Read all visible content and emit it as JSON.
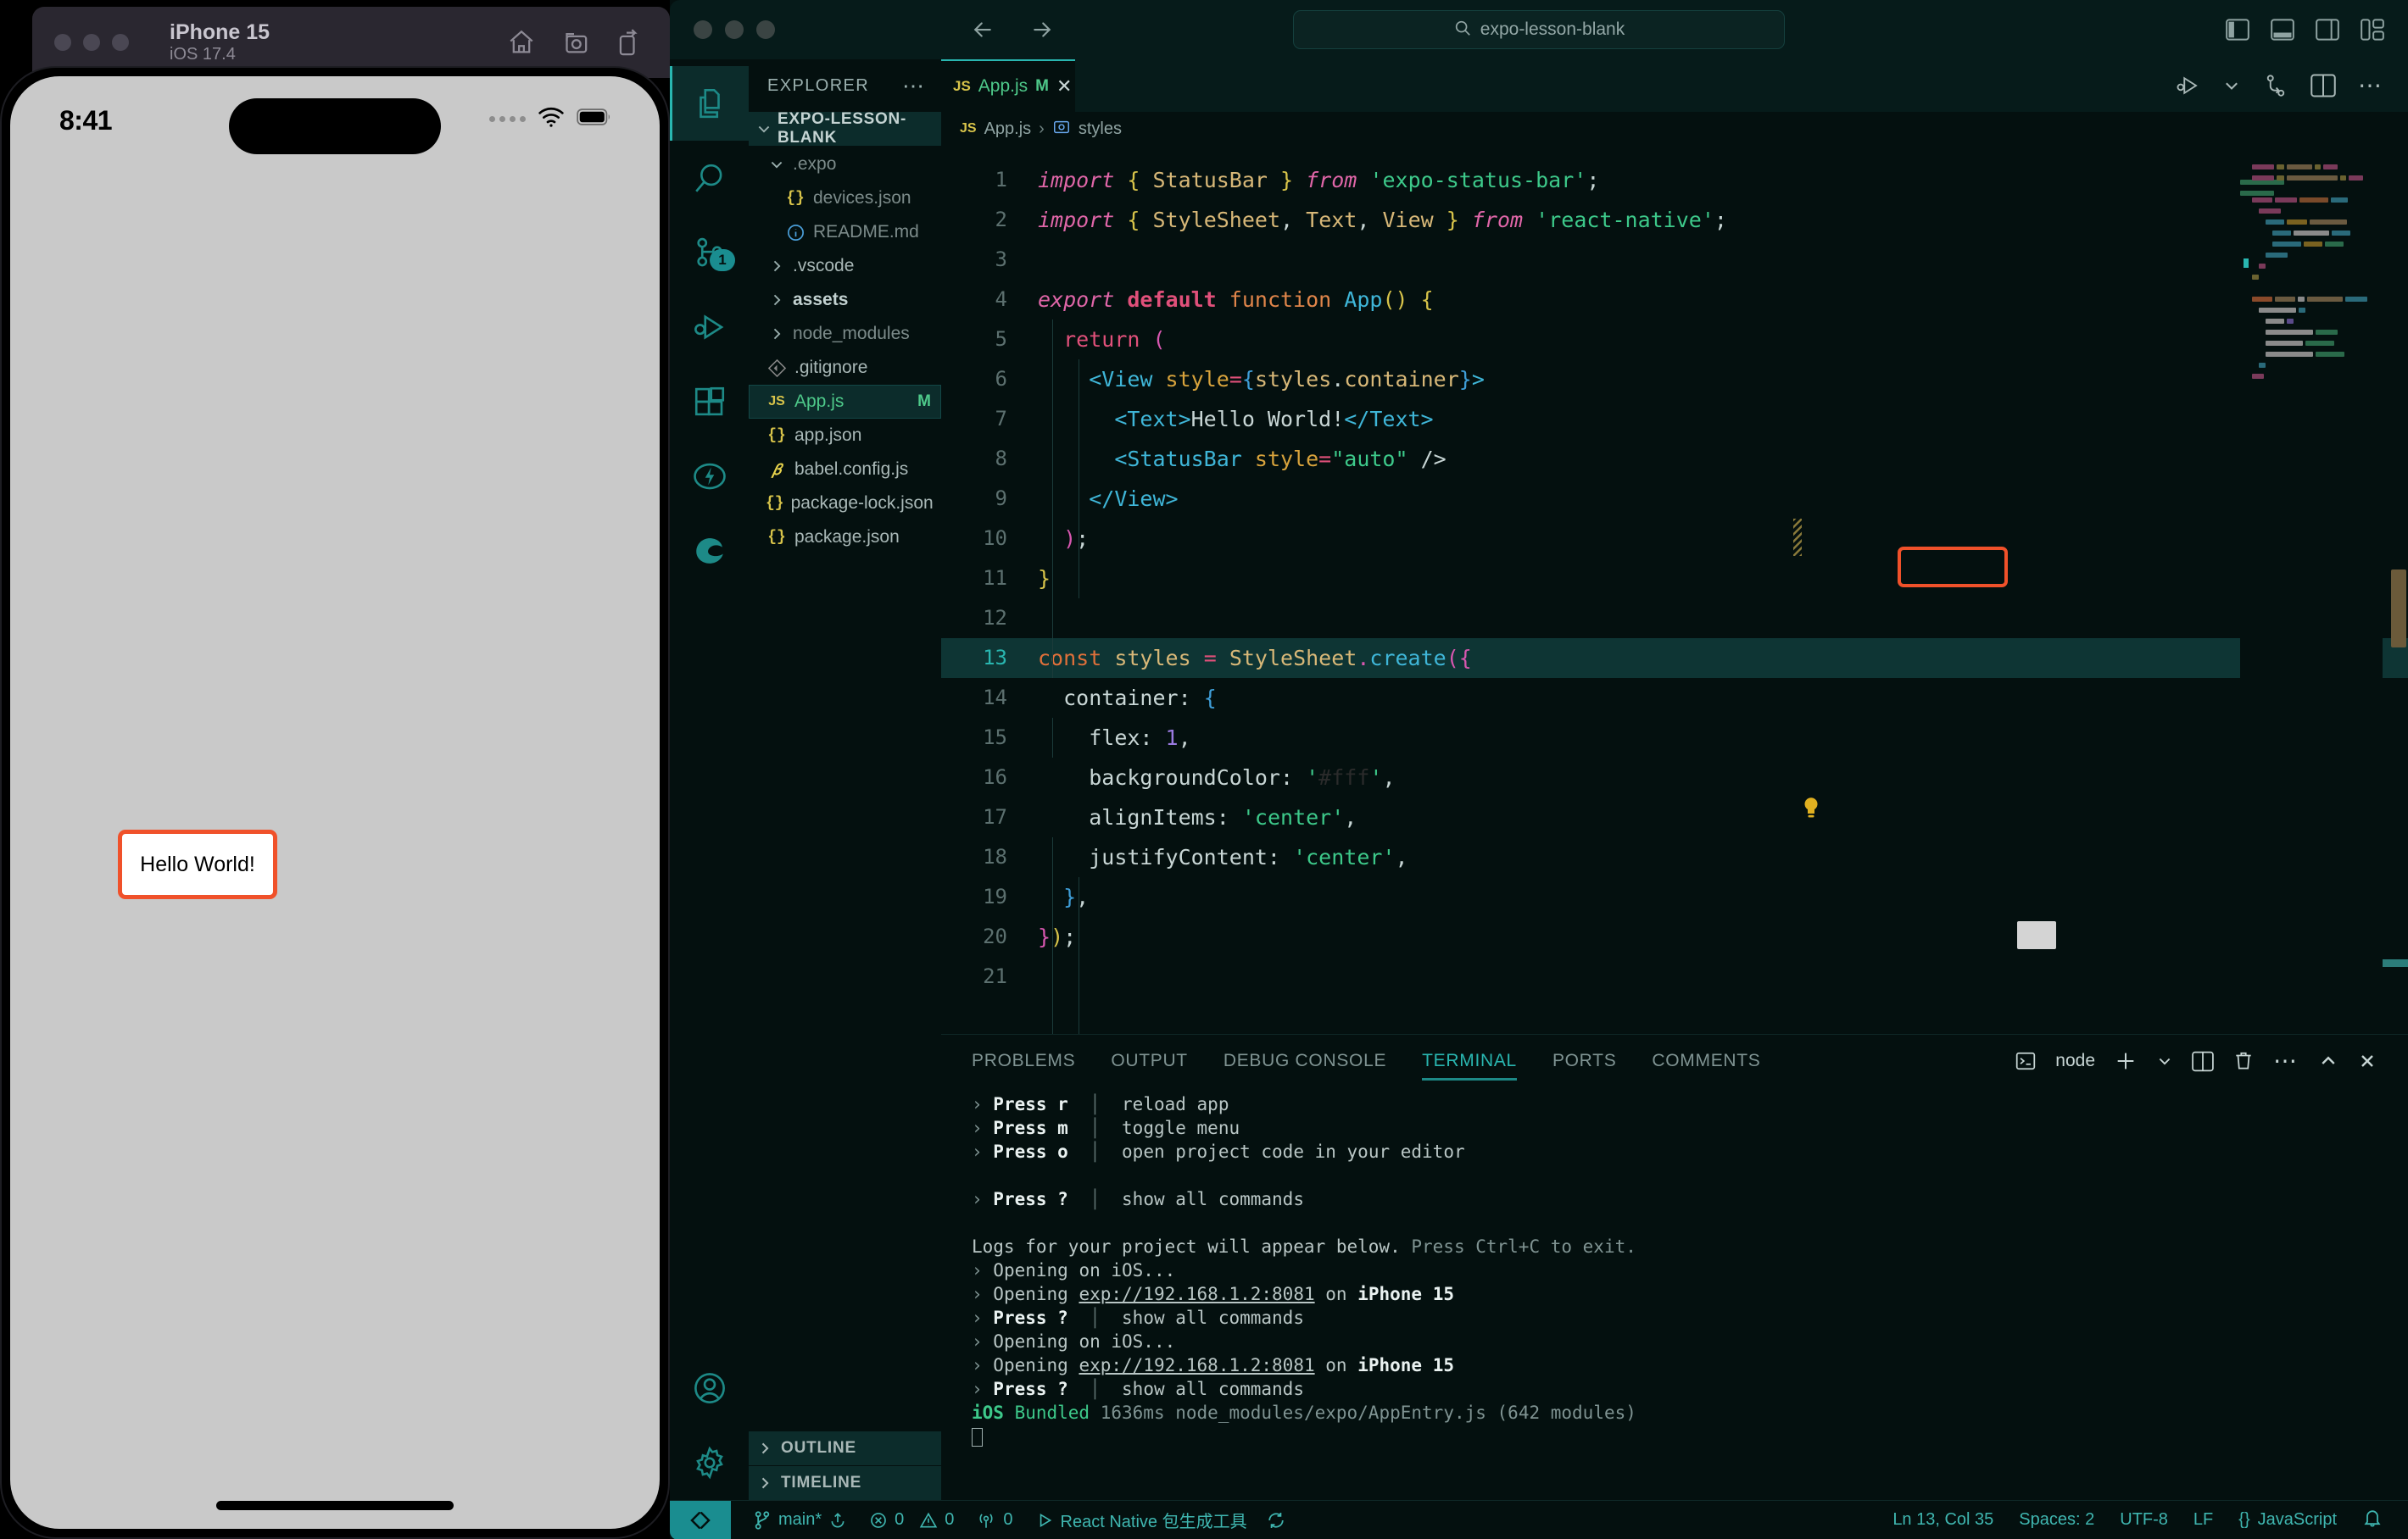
{
  "simulator": {
    "window_lights": [
      "close",
      "minimize",
      "maximize"
    ],
    "device_name": "iPhone 15",
    "os_version": "iOS 17.4",
    "toolbar_icons": [
      "home-icon",
      "screenshot-icon",
      "rotate-icon"
    ],
    "status_time": "8:41",
    "status_icons": [
      "cellular-dots-icon",
      "wifi-icon",
      "battery-icon"
    ],
    "app": {
      "text": "Hello World!",
      "highlight_color": "#f0512a",
      "background": "#ffffff"
    }
  },
  "titlebar": {
    "lights": [
      "close",
      "minimize",
      "maximize"
    ],
    "back_label": "back-arrow",
    "forward_label": "forward-arrow",
    "search_text": "expo-lesson-blank",
    "layout_icons": [
      "toggle-primary-sidebar",
      "toggle-panel",
      "toggle-secondary-sidebar",
      "customize-layout"
    ]
  },
  "activitybar": {
    "items": [
      {
        "name": "explorer",
        "icon": "files-icon",
        "active": true,
        "badge": null
      },
      {
        "name": "search",
        "icon": "search-icon",
        "active": false,
        "badge": null
      },
      {
        "name": "source-control",
        "icon": "source-control-icon",
        "active": false,
        "badge": "1"
      },
      {
        "name": "run-debug",
        "icon": "run-debug-icon",
        "active": false,
        "badge": null
      },
      {
        "name": "extensions",
        "icon": "extensions-icon",
        "active": false,
        "badge": null
      },
      {
        "name": "expo-tools",
        "icon": "lightning-icon",
        "active": false,
        "badge": null
      },
      {
        "name": "edge-tools",
        "icon": "edge-icon",
        "active": false,
        "badge": null
      }
    ],
    "bottom": [
      {
        "name": "accounts",
        "icon": "account-icon"
      },
      {
        "name": "manage",
        "icon": "gear-icon"
      }
    ]
  },
  "sidebar": {
    "header": "EXPLORER",
    "more_icon": "ellipsis-icon",
    "root": "EXPO-LESSON-BLANK",
    "files": [
      {
        "label": ".expo",
        "icon": "folder",
        "indent": 1,
        "chevron": "down",
        "style": "dim",
        "mark": ""
      },
      {
        "label": "devices.json",
        "icon": "json",
        "indent": 2,
        "chevron": "",
        "style": "dim",
        "mark": ""
      },
      {
        "label": "README.md",
        "icon": "md",
        "indent": 2,
        "chevron": "",
        "style": "dim",
        "mark": ""
      },
      {
        "label": ".vscode",
        "icon": "folder",
        "indent": 1,
        "chevron": "right",
        "style": "",
        "mark": ""
      },
      {
        "label": "assets",
        "icon": "folder",
        "indent": 1,
        "chevron": "right",
        "style": "bold",
        "mark": ""
      },
      {
        "label": "node_modules",
        "icon": "folder",
        "indent": 1,
        "chevron": "right",
        "style": "dim",
        "mark": ""
      },
      {
        "label": ".gitignore",
        "icon": "git",
        "indent": 1,
        "chevron": "",
        "style": "",
        "mark": ""
      },
      {
        "label": "App.js",
        "icon": "js",
        "indent": 1,
        "chevron": "",
        "style": "green",
        "mark": "M",
        "selected": true
      },
      {
        "label": "app.json",
        "icon": "json",
        "indent": 1,
        "chevron": "",
        "style": "",
        "mark": ""
      },
      {
        "label": "babel.config.js",
        "icon": "babel",
        "indent": 1,
        "chevron": "",
        "style": "",
        "mark": ""
      },
      {
        "label": "package-lock.json",
        "icon": "json",
        "indent": 1,
        "chevron": "",
        "style": "",
        "mark": ""
      },
      {
        "label": "package.json",
        "icon": "json",
        "indent": 1,
        "chevron": "",
        "style": "",
        "mark": ""
      }
    ],
    "sections": [
      "OUTLINE",
      "TIMELINE"
    ]
  },
  "editor": {
    "tab": {
      "icon": "JS",
      "name": "App.js",
      "modified": "M",
      "close": "✕"
    },
    "toolbar_icons": [
      "run-debug-icon",
      "chevron-down-icon",
      "source-control-icon",
      "split-editor-icon",
      "more-actions-icon"
    ],
    "breadcrumb": {
      "file_icon": "JS",
      "file": "App.js",
      "separator": "›",
      "symbol_icon": "variable-icon",
      "symbol": "styles"
    },
    "cursor_line": 13,
    "highlight_box_color": "#f0512a",
    "color_swatch": "#ffffff",
    "lines": [
      {
        "n": 1,
        "text": "import { StatusBar } from 'expo-status-bar';"
      },
      {
        "n": 2,
        "text": "import { StyleSheet, Text, View } from 'react-native';"
      },
      {
        "n": 3,
        "text": ""
      },
      {
        "n": 4,
        "text": "export default function App() {"
      },
      {
        "n": 5,
        "text": "  return ("
      },
      {
        "n": 6,
        "text": "    <View style={styles.container}>"
      },
      {
        "n": 7,
        "text": "      <Text>Hello World!</Text>"
      },
      {
        "n": 8,
        "text": "      <StatusBar style=\"auto\" />"
      },
      {
        "n": 9,
        "text": "    </View>"
      },
      {
        "n": 10,
        "text": "  );"
      },
      {
        "n": 11,
        "text": "}"
      },
      {
        "n": 12,
        "text": ""
      },
      {
        "n": 13,
        "text": "const styles = StyleSheet.create({"
      },
      {
        "n": 14,
        "text": "  container: {"
      },
      {
        "n": 15,
        "text": "    flex: 1,"
      },
      {
        "n": 16,
        "text": "    backgroundColor: '#fff',"
      },
      {
        "n": 17,
        "text": "    alignItems: 'center',"
      },
      {
        "n": 18,
        "text": "    justifyContent: 'center',"
      },
      {
        "n": 19,
        "text": "  },"
      },
      {
        "n": 20,
        "text": "});"
      },
      {
        "n": 21,
        "text": ""
      }
    ]
  },
  "panel": {
    "tabs": [
      "PROBLEMS",
      "OUTPUT",
      "DEBUG CONSOLE",
      "TERMINAL",
      "PORTS",
      "COMMENTS"
    ],
    "active_tab": "TERMINAL",
    "shell_label": "node",
    "actions": [
      "terminal-icon",
      "new-terminal-icon",
      "chevron-down-icon",
      "split-terminal-icon",
      "kill-terminal-icon",
      "more-actions-icon",
      "maximize-panel-icon",
      "close-panel-icon"
    ],
    "terminal_lines": [
      {
        "type": "cmd",
        "arrow": "›",
        "key": "Press r",
        "pipe": "│",
        "desc": "reload app"
      },
      {
        "type": "cmd",
        "arrow": "›",
        "key": "Press m",
        "pipe": "│",
        "desc": "toggle menu"
      },
      {
        "type": "cmd",
        "arrow": "›",
        "key": "Press o",
        "pipe": "│",
        "desc": "open project code in your editor"
      },
      {
        "type": "blank"
      },
      {
        "type": "cmd",
        "arrow": "›",
        "key": "Press ?",
        "pipe": "│",
        "desc": "show all commands"
      },
      {
        "type": "blank"
      },
      {
        "type": "logs",
        "text": "Logs for your project will appear below.",
        "dim": "Press Ctrl+C to exit."
      },
      {
        "type": "plain",
        "arrow": "›",
        "text": "Opening on iOS..."
      },
      {
        "type": "open",
        "arrow": "›",
        "pre": "Opening ",
        "url": "exp://192.168.1.2:8081",
        "mid": " on ",
        "device": "iPhone 15"
      },
      {
        "type": "cmd",
        "arrow": "›",
        "key": "Press ?",
        "pipe": "│",
        "desc": "show all commands"
      },
      {
        "type": "plain",
        "arrow": "›",
        "text": "Opening on iOS..."
      },
      {
        "type": "open",
        "arrow": "›",
        "pre": "Opening ",
        "url": "exp://192.168.1.2:8081",
        "mid": " on ",
        "device": "iPhone 15"
      },
      {
        "type": "cmd",
        "arrow": "›",
        "key": "Press ?",
        "pipe": "│",
        "desc": "show all commands"
      },
      {
        "type": "bundle",
        "tag": "iOS",
        "word": "Bundled",
        "rest": "1636ms node_modules/expo/AppEntry.js (642 modules)"
      }
    ]
  },
  "statusbar": {
    "remote_icon": "remote-window-icon",
    "branch": "main*",
    "sync_icon": "sync-icon",
    "errors": "0",
    "warnings": "0",
    "ports": "0",
    "task": "React Native 包生成工具",
    "task_refresh_icon": "refresh-icon",
    "position": "Ln 13, Col 35",
    "spaces": "Spaces: 2",
    "encoding": "UTF-8",
    "eol": "LF",
    "language": "JavaScript",
    "bell_icon": "bell-icon"
  }
}
